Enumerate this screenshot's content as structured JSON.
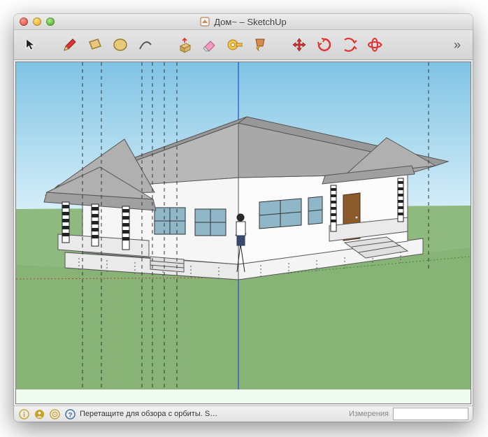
{
  "window": {
    "title": "Дом~ – SketchUp"
  },
  "toolbar": {
    "tools": [
      {
        "name": "select",
        "svg": "cursor"
      },
      {
        "name": "pencil",
        "svg": "pencil"
      },
      {
        "name": "rectangle",
        "svg": "rect"
      },
      {
        "name": "circle",
        "svg": "circle"
      },
      {
        "name": "arc",
        "svg": "arc"
      },
      {
        "name": "pushpull",
        "svg": "pushpull"
      },
      {
        "name": "eraser",
        "svg": "eraser"
      },
      {
        "name": "tape",
        "svg": "tape"
      },
      {
        "name": "paint",
        "svg": "paint"
      },
      {
        "name": "move",
        "svg": "move"
      },
      {
        "name": "rotate",
        "svg": "rotate"
      },
      {
        "name": "scale",
        "svg": "scale"
      },
      {
        "name": "orbit",
        "svg": "orbit"
      }
    ]
  },
  "status": {
    "hint": "Перетащите для обзора с орбиты.  S…",
    "measurements_label": "Измерения",
    "measurements_value": ""
  }
}
